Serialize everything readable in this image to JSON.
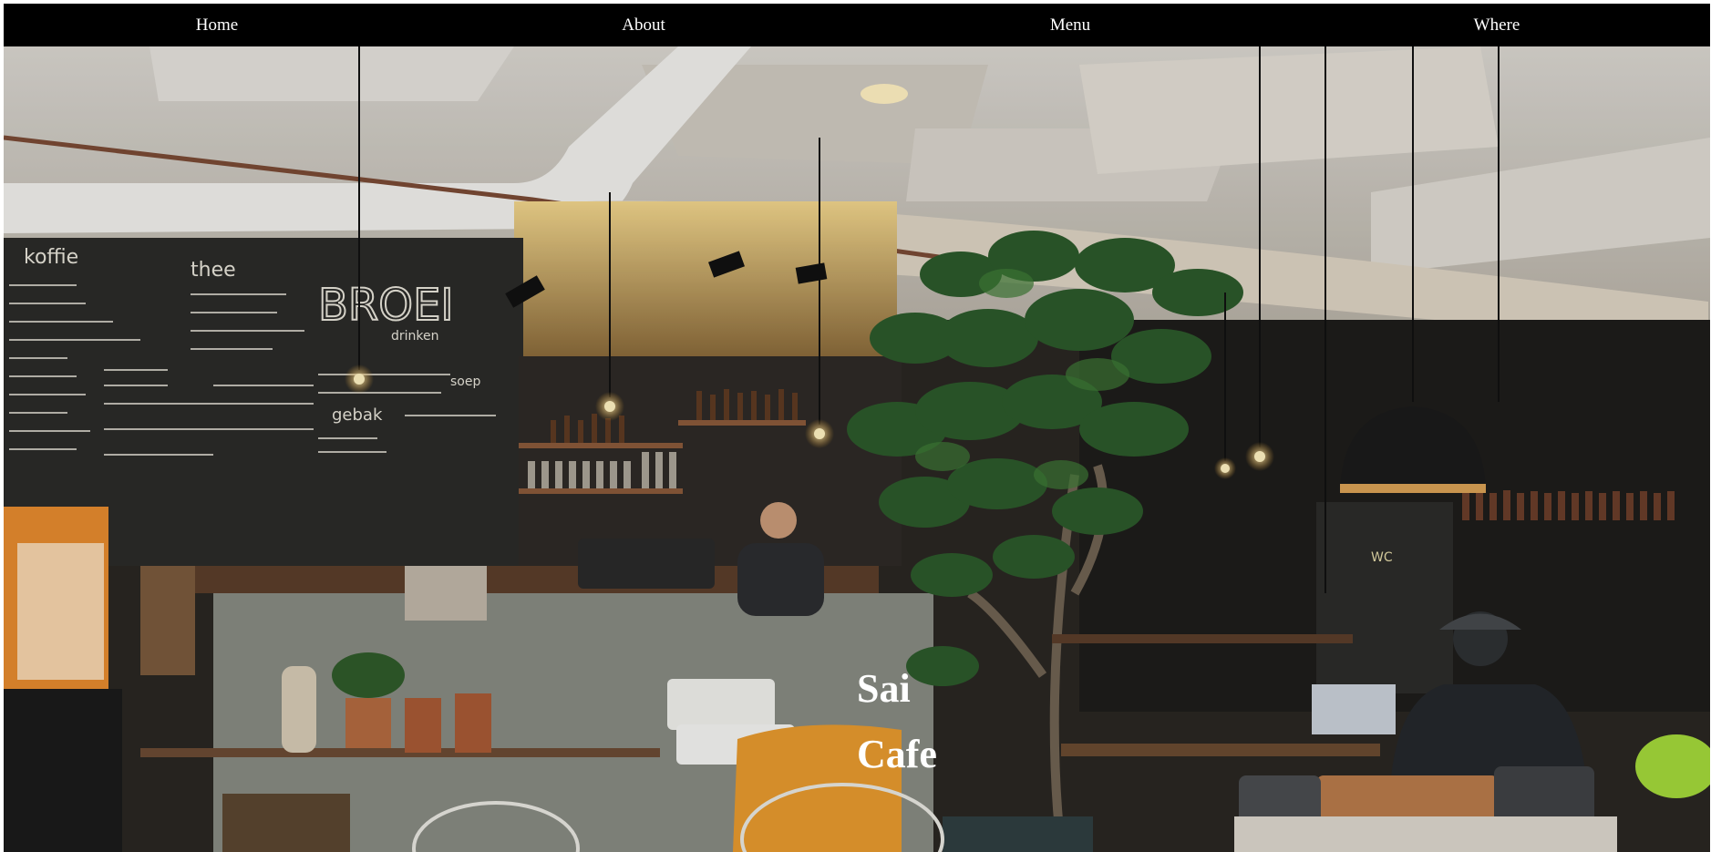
{
  "nav": {
    "items": [
      {
        "label": "Home"
      },
      {
        "label": "About"
      },
      {
        "label": "Menu"
      },
      {
        "label": "Where"
      }
    ]
  },
  "hero": {
    "title_line_1": "Sai",
    "title_line_2": "Cafe",
    "image": "cafe-interior-photo",
    "chalkboard_text": [
      "koffie",
      "thee",
      "BROEI",
      "drinken",
      "gebak",
      "soep",
      "WC"
    ]
  },
  "colors": {
    "nav_background": "#000000",
    "nav_text": "#ffffff",
    "title_text": "#ffffff"
  }
}
